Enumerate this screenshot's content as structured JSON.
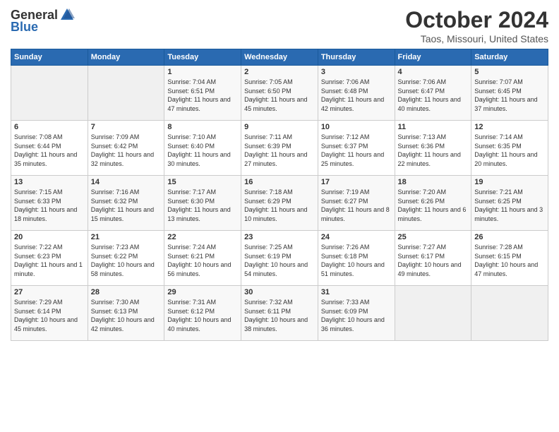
{
  "logo": {
    "general": "General",
    "blue": "Blue"
  },
  "title": "October 2024",
  "subtitle": "Taos, Missouri, United States",
  "days_header": [
    "Sunday",
    "Monday",
    "Tuesday",
    "Wednesday",
    "Thursday",
    "Friday",
    "Saturday"
  ],
  "weeks": [
    [
      {
        "day": "",
        "info": ""
      },
      {
        "day": "",
        "info": ""
      },
      {
        "day": "1",
        "info": "Sunrise: 7:04 AM\nSunset: 6:51 PM\nDaylight: 11 hours and 47 minutes."
      },
      {
        "day": "2",
        "info": "Sunrise: 7:05 AM\nSunset: 6:50 PM\nDaylight: 11 hours and 45 minutes."
      },
      {
        "day": "3",
        "info": "Sunrise: 7:06 AM\nSunset: 6:48 PM\nDaylight: 11 hours and 42 minutes."
      },
      {
        "day": "4",
        "info": "Sunrise: 7:06 AM\nSunset: 6:47 PM\nDaylight: 11 hours and 40 minutes."
      },
      {
        "day": "5",
        "info": "Sunrise: 7:07 AM\nSunset: 6:45 PM\nDaylight: 11 hours and 37 minutes."
      }
    ],
    [
      {
        "day": "6",
        "info": "Sunrise: 7:08 AM\nSunset: 6:44 PM\nDaylight: 11 hours and 35 minutes."
      },
      {
        "day": "7",
        "info": "Sunrise: 7:09 AM\nSunset: 6:42 PM\nDaylight: 11 hours and 32 minutes."
      },
      {
        "day": "8",
        "info": "Sunrise: 7:10 AM\nSunset: 6:40 PM\nDaylight: 11 hours and 30 minutes."
      },
      {
        "day": "9",
        "info": "Sunrise: 7:11 AM\nSunset: 6:39 PM\nDaylight: 11 hours and 27 minutes."
      },
      {
        "day": "10",
        "info": "Sunrise: 7:12 AM\nSunset: 6:37 PM\nDaylight: 11 hours and 25 minutes."
      },
      {
        "day": "11",
        "info": "Sunrise: 7:13 AM\nSunset: 6:36 PM\nDaylight: 11 hours and 22 minutes."
      },
      {
        "day": "12",
        "info": "Sunrise: 7:14 AM\nSunset: 6:35 PM\nDaylight: 11 hours and 20 minutes."
      }
    ],
    [
      {
        "day": "13",
        "info": "Sunrise: 7:15 AM\nSunset: 6:33 PM\nDaylight: 11 hours and 18 minutes."
      },
      {
        "day": "14",
        "info": "Sunrise: 7:16 AM\nSunset: 6:32 PM\nDaylight: 11 hours and 15 minutes."
      },
      {
        "day": "15",
        "info": "Sunrise: 7:17 AM\nSunset: 6:30 PM\nDaylight: 11 hours and 13 minutes."
      },
      {
        "day": "16",
        "info": "Sunrise: 7:18 AM\nSunset: 6:29 PM\nDaylight: 11 hours and 10 minutes."
      },
      {
        "day": "17",
        "info": "Sunrise: 7:19 AM\nSunset: 6:27 PM\nDaylight: 11 hours and 8 minutes."
      },
      {
        "day": "18",
        "info": "Sunrise: 7:20 AM\nSunset: 6:26 PM\nDaylight: 11 hours and 6 minutes."
      },
      {
        "day": "19",
        "info": "Sunrise: 7:21 AM\nSunset: 6:25 PM\nDaylight: 11 hours and 3 minutes."
      }
    ],
    [
      {
        "day": "20",
        "info": "Sunrise: 7:22 AM\nSunset: 6:23 PM\nDaylight: 11 hours and 1 minute."
      },
      {
        "day": "21",
        "info": "Sunrise: 7:23 AM\nSunset: 6:22 PM\nDaylight: 10 hours and 58 minutes."
      },
      {
        "day": "22",
        "info": "Sunrise: 7:24 AM\nSunset: 6:21 PM\nDaylight: 10 hours and 56 minutes."
      },
      {
        "day": "23",
        "info": "Sunrise: 7:25 AM\nSunset: 6:19 PM\nDaylight: 10 hours and 54 minutes."
      },
      {
        "day": "24",
        "info": "Sunrise: 7:26 AM\nSunset: 6:18 PM\nDaylight: 10 hours and 51 minutes."
      },
      {
        "day": "25",
        "info": "Sunrise: 7:27 AM\nSunset: 6:17 PM\nDaylight: 10 hours and 49 minutes."
      },
      {
        "day": "26",
        "info": "Sunrise: 7:28 AM\nSunset: 6:15 PM\nDaylight: 10 hours and 47 minutes."
      }
    ],
    [
      {
        "day": "27",
        "info": "Sunrise: 7:29 AM\nSunset: 6:14 PM\nDaylight: 10 hours and 45 minutes."
      },
      {
        "day": "28",
        "info": "Sunrise: 7:30 AM\nSunset: 6:13 PM\nDaylight: 10 hours and 42 minutes."
      },
      {
        "day": "29",
        "info": "Sunrise: 7:31 AM\nSunset: 6:12 PM\nDaylight: 10 hours and 40 minutes."
      },
      {
        "day": "30",
        "info": "Sunrise: 7:32 AM\nSunset: 6:11 PM\nDaylight: 10 hours and 38 minutes."
      },
      {
        "day": "31",
        "info": "Sunrise: 7:33 AM\nSunset: 6:09 PM\nDaylight: 10 hours and 36 minutes."
      },
      {
        "day": "",
        "info": ""
      },
      {
        "day": "",
        "info": ""
      }
    ]
  ]
}
